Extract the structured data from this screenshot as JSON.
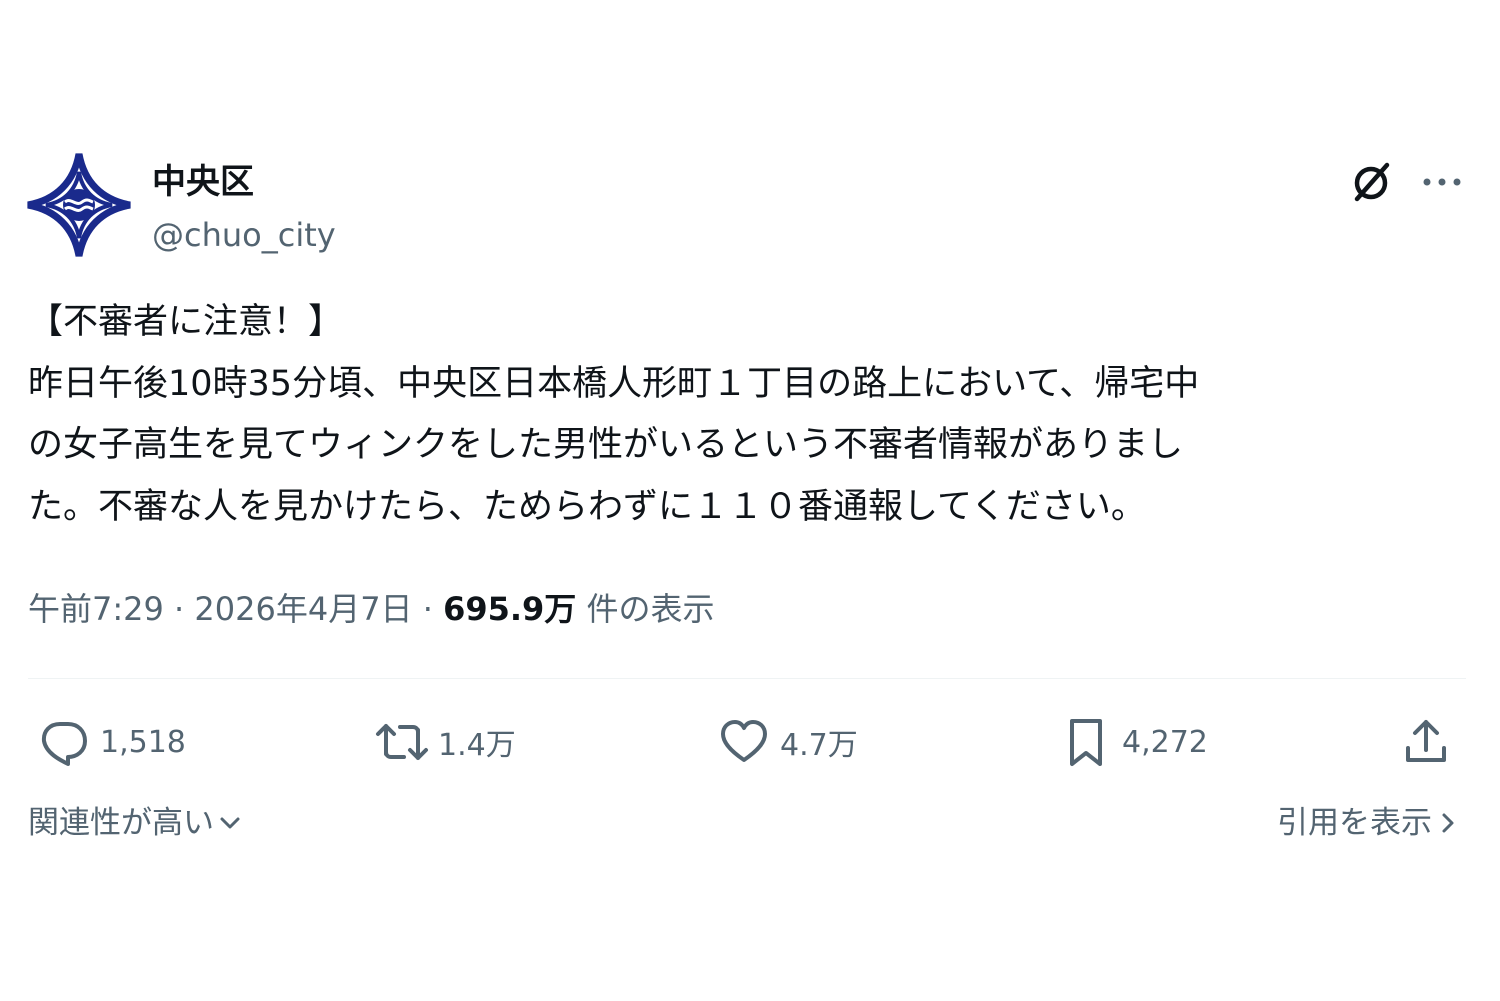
{
  "account": {
    "display_name": "中央区",
    "handle": "@chuo_city",
    "avatar_icon": "chuo-ward-emblem-icon",
    "accent_color": "#1a2a8c"
  },
  "header_actions": {
    "grok_icon": "grok-icon",
    "more_icon": "more-icon"
  },
  "post": {
    "lines": [
      "【不審者に注意！】",
      "昨日午後10時35分頃、中央区日本橋人形町１丁目の路上において、帰宅中",
      "の女子高生を見てウィンクをした男性がいるという不審者情報がありまし",
      "た。不審な人を見かけたら、ためらわずに１１０番通報してください。"
    ],
    "time": "午前7:29",
    "separator": " · ",
    "date": "2026年4月7日",
    "views": "695.9万",
    "views_label": " 件の表示"
  },
  "actions": {
    "reply": {
      "icon": "reply-icon",
      "count": "1,518"
    },
    "repost": {
      "icon": "repost-icon",
      "count": "1.4万"
    },
    "like": {
      "icon": "heart-icon",
      "count": "4.7万"
    },
    "bookmark": {
      "icon": "bookmark-icon",
      "count": "4,272"
    },
    "share": {
      "icon": "share-icon"
    }
  },
  "footer": {
    "sort_label": "関連性が高い",
    "quotes_label": "引用を表示"
  },
  "colors": {
    "text_primary": "#0f1419",
    "text_secondary": "#536471",
    "divider": "#eff3f4"
  }
}
